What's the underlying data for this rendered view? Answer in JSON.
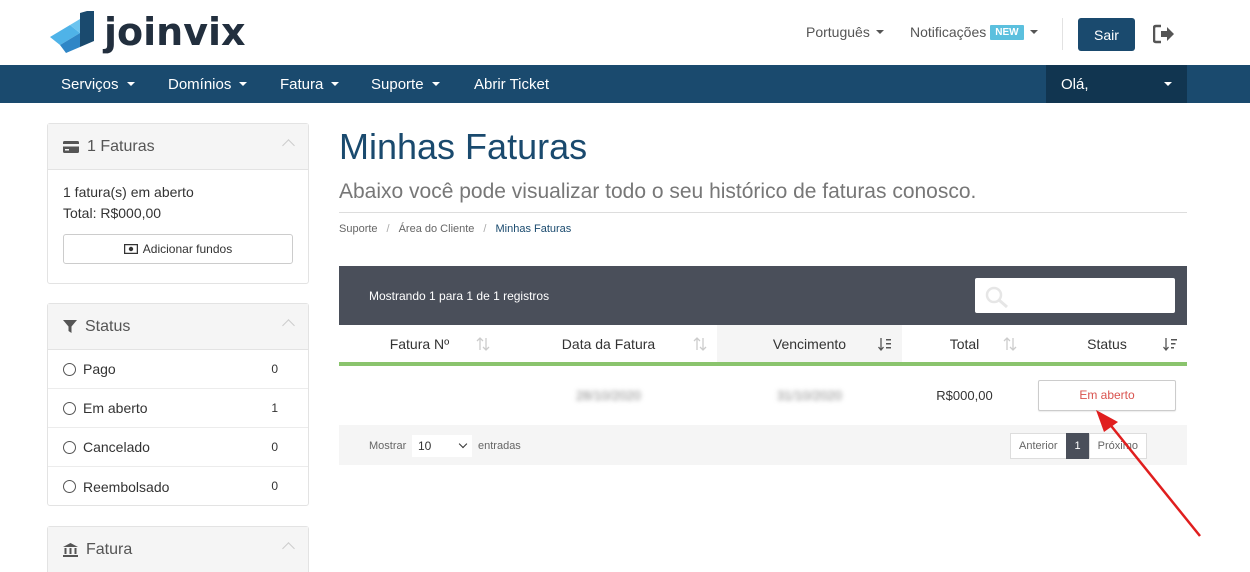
{
  "header": {
    "brand": "joinvix",
    "language": "Português",
    "notifications": "Notificações",
    "new_badge": "NEW",
    "logout_label": "Sair"
  },
  "nav": {
    "items": [
      {
        "label": "Serviços"
      },
      {
        "label": "Domínios"
      },
      {
        "label": "Fatura"
      },
      {
        "label": "Suporte"
      },
      {
        "label": "Abrir Ticket"
      }
    ],
    "user": "Olá,"
  },
  "sidebar": {
    "invoices_panel": {
      "title": "1 Faturas",
      "open_text": "1 fatura(s) em aberto",
      "total_text": "Total: R$000,00",
      "add_funds": "Adicionar fundos"
    },
    "status_panel": {
      "title": "Status",
      "items": [
        {
          "label": "Pago",
          "count": "0"
        },
        {
          "label": "Em aberto",
          "count": "1"
        },
        {
          "label": "Cancelado",
          "count": "0"
        },
        {
          "label": "Reembolsado",
          "count": "0"
        }
      ]
    },
    "billing_panel": {
      "title": "Fatura"
    }
  },
  "main": {
    "title": "Minhas Faturas",
    "subtitle": "Abaixo você pode visualizar todo o seu histórico de faturas conosco.",
    "breadcrumb": [
      "Suporte",
      "Área do Cliente",
      "Minhas Faturas"
    ],
    "table": {
      "info": "Mostrando 1 para 1 de 1 registros",
      "columns": [
        "Fatura Nº",
        "Data da Fatura",
        "Vencimento",
        "Total",
        "Status"
      ],
      "rows": [
        {
          "number": "",
          "date": "28/10/2020",
          "due": "31/10/2020",
          "total": "R$000,00",
          "status": "Em aberto"
        }
      ],
      "show_label": "Mostrar",
      "page_size": "10",
      "entries_label": "entradas",
      "prev": "Anterior",
      "page": "1",
      "next": "Próximo"
    }
  },
  "colors": {
    "primary": "#1a4a6e",
    "nav_dark": "#113550",
    "accent_green": "#8ac46d",
    "status_red": "#d9534f",
    "arrow_red": "#e01e1e"
  }
}
